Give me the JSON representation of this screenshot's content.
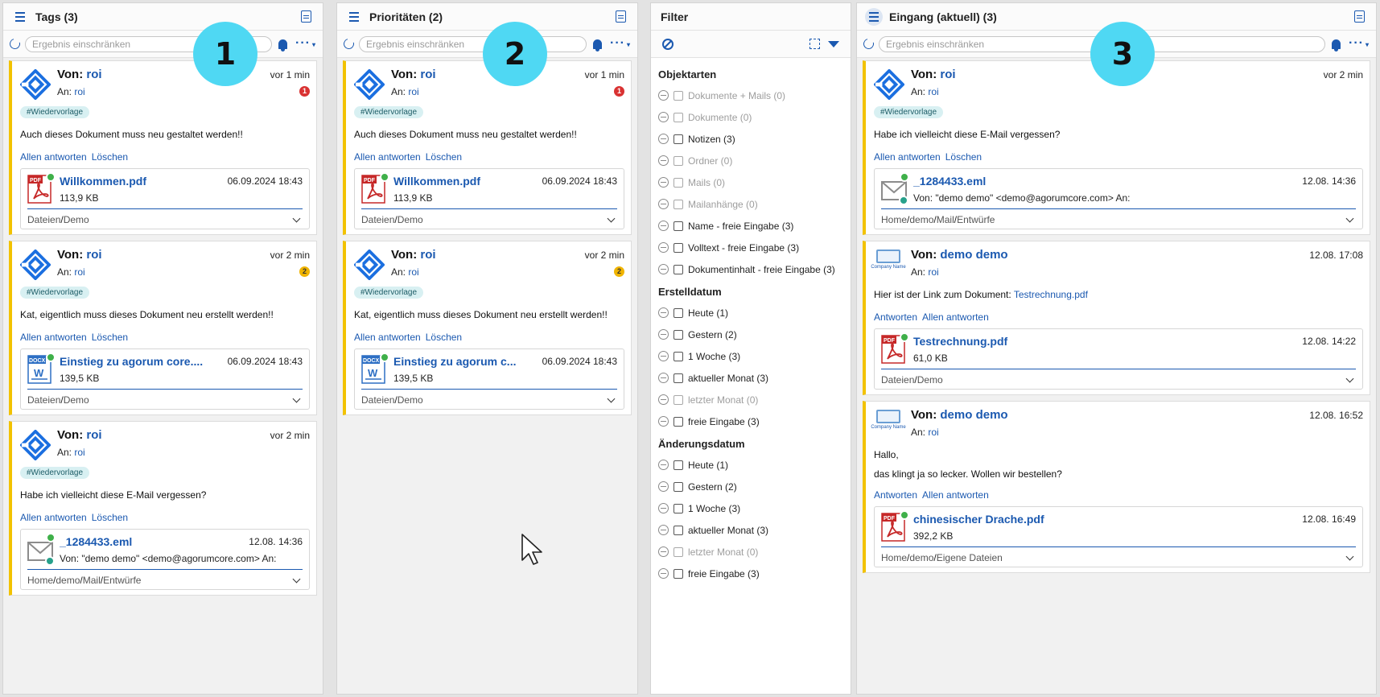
{
  "panel1": {
    "title": "Tags (3)",
    "search_placeholder": "Ergebnis einschränken",
    "marker": "1",
    "cards": [
      {
        "from_label": "Von:",
        "from": "roi",
        "to_label": "An:",
        "to": "roi",
        "time": "vor 1 min",
        "badge": "1",
        "tag": "#Wiedervorlage",
        "message": "Auch dieses Dokument muss neu gestaltet werden!!",
        "actions": [
          "Allen antworten",
          "Löschen"
        ],
        "attachment": {
          "name": "Willkommen.pdf",
          "size": "113,9 KB",
          "date": "06.09.2024 18:43",
          "path": [
            "Dateien",
            "/",
            "Demo"
          ]
        }
      },
      {
        "from_label": "Von:",
        "from": "roi",
        "to_label": "An:",
        "to": "roi",
        "time": "vor 2 min",
        "badge": "2",
        "tag": "#Wiedervorlage",
        "message": "Kat, eigentlich muss dieses Dokument neu erstellt werden!!",
        "actions": [
          "Allen antworten",
          "Löschen"
        ],
        "attachment": {
          "name": "Einstieg zu agorum core....",
          "size": "139,5 KB",
          "date": "06.09.2024 18:43",
          "path": [
            "Dateien",
            "/",
            "Demo"
          ]
        }
      },
      {
        "from_label": "Von:",
        "from": "roi",
        "to_label": "An:",
        "to": "roi",
        "time": "vor 2 min",
        "tag": "#Wiedervorlage",
        "message": "Habe ich vielleicht diese E-Mail vergessen?",
        "actions": [
          "Allen antworten",
          "Löschen"
        ],
        "attachment": {
          "name": "_1284433.eml",
          "size": "Von: \"demo demo\" <demo@agorumcore.com>   An:",
          "date": "12.08. 14:36",
          "path": [
            "Home",
            "/",
            "demo",
            "/",
            "Mail",
            "/",
            "Entwürfe"
          ]
        }
      }
    ]
  },
  "panel2": {
    "title": "Prioritäten (2)",
    "search_placeholder": "Ergebnis einschränken",
    "marker": "2",
    "cards": [
      {
        "from_label": "Von:",
        "from": "roi",
        "to_label": "An:",
        "to": "roi",
        "time": "vor 1 min",
        "badge": "1",
        "tag": "#Wiedervorlage",
        "message": "Auch dieses Dokument muss neu gestaltet werden!!",
        "actions": [
          "Allen antworten",
          "Löschen"
        ],
        "attachment": {
          "name": "Willkommen.pdf",
          "size": "113,9 KB",
          "date": "06.09.2024 18:43",
          "path": [
            "Dateien",
            "/",
            "Demo"
          ]
        }
      },
      {
        "from_label": "Von:",
        "from": "roi",
        "to_label": "An:",
        "to": "roi",
        "time": "vor 2 min",
        "badge": "2",
        "tag": "#Wiedervorlage",
        "message": "Kat, eigentlich muss dieses Dokument neu erstellt werden!!",
        "actions": [
          "Allen antworten",
          "Löschen"
        ],
        "attachment": {
          "name": "Einstieg zu agorum c...",
          "size": "139,5 KB",
          "date": "06.09.2024 18:43",
          "path": [
            "Dateien",
            "/",
            "Demo"
          ]
        }
      }
    ]
  },
  "filter": {
    "title": "Filter",
    "sections": [
      {
        "heading": "Objektarten",
        "items": [
          {
            "label": "Dokumente + Mails (0)",
            "enabled": false
          },
          {
            "label": "Dokumente (0)",
            "enabled": false
          },
          {
            "label": "Notizen (3)",
            "enabled": true
          },
          {
            "label": "Ordner (0)",
            "enabled": false
          },
          {
            "label": "Mails (0)",
            "enabled": false
          },
          {
            "label": "Mailanhänge (0)",
            "enabled": false
          },
          {
            "label": "Name - freie Eingabe (3)",
            "enabled": true
          },
          {
            "label": "Volltext - freie Eingabe (3)",
            "enabled": true
          },
          {
            "label": "Dokumentinhalt - freie Eingabe (3)",
            "enabled": true
          }
        ]
      },
      {
        "heading": "Erstelldatum",
        "items": [
          {
            "label": "Heute (1)",
            "enabled": true
          },
          {
            "label": "Gestern (2)",
            "enabled": true
          },
          {
            "label": "1 Woche (3)",
            "enabled": true
          },
          {
            "label": "aktueller Monat (3)",
            "enabled": true
          },
          {
            "label": "letzter Monat (0)",
            "enabled": false
          },
          {
            "label": "freie Eingabe (3)",
            "enabled": true
          }
        ]
      },
      {
        "heading": "Änderungsdatum",
        "items": [
          {
            "label": "Heute (1)",
            "enabled": true
          },
          {
            "label": "Gestern (2)",
            "enabled": true
          },
          {
            "label": "1 Woche (3)",
            "enabled": true
          },
          {
            "label": "aktueller Monat (3)",
            "enabled": true
          },
          {
            "label": "letzter Monat (0)",
            "enabled": false
          },
          {
            "label": "freie Eingabe (3)",
            "enabled": true
          }
        ]
      }
    ]
  },
  "panel3": {
    "title": "Eingang (aktuell) (3)",
    "search_placeholder": "Ergebnis einschränken",
    "marker": "3",
    "cards": [
      {
        "from_label": "Von:",
        "from": "roi",
        "to_label": "An:",
        "to": "roi",
        "time": "vor 2 min",
        "tag": "#Wiedervorlage",
        "message": "Habe ich vielleicht diese E-Mail vergessen?",
        "actions": [
          "Allen antworten",
          "Löschen"
        ],
        "attachment": {
          "name": "_1284433.eml",
          "size": "Von: \"demo demo\" <demo@agorumcore.com>   An:",
          "date": "12.08. 14:36",
          "path": [
            "Home",
            "/",
            "demo",
            "/",
            "Mail",
            "/",
            "Entwürfe"
          ]
        }
      },
      {
        "from_label": "Von:",
        "from": "demo demo",
        "to_label": "An:",
        "to": "roi",
        "time": "12.08. 17:08",
        "message": "Hier ist der Link zum Dokument: ",
        "message_link": "Testrechnung.pdf",
        "actions": [
          "Antworten",
          "Allen antworten"
        ],
        "attachment": {
          "name": "Testrechnung.pdf",
          "size": "61,0 KB",
          "date": "12.08. 14:22",
          "path": [
            "Dateien",
            "/",
            "Demo"
          ]
        }
      },
      {
        "from_label": "Von:",
        "from": "demo demo",
        "to_label": "An:",
        "to": "roi",
        "time": "12.08. 16:52",
        "message": "Hallo,",
        "message2": "das klingt ja so lecker. Wollen wir bestellen?",
        "actions": [
          "Antworten",
          "Allen antworten"
        ],
        "attachment": {
          "name": "chinesischer Drache.pdf",
          "size": "392,2 KB",
          "date": "12.08. 16:49",
          "path": [
            "Home",
            "/",
            "demo",
            "/",
            "Eigene Dateien"
          ]
        }
      }
    ]
  },
  "company_logo_text": "Company Name",
  "colors": {
    "accent": "#1b59b0",
    "card_bar": "#f2c200",
    "marker": "#4fd8f3",
    "pdf_red": "#c62828",
    "docx_blue": "#2d6fc4"
  }
}
